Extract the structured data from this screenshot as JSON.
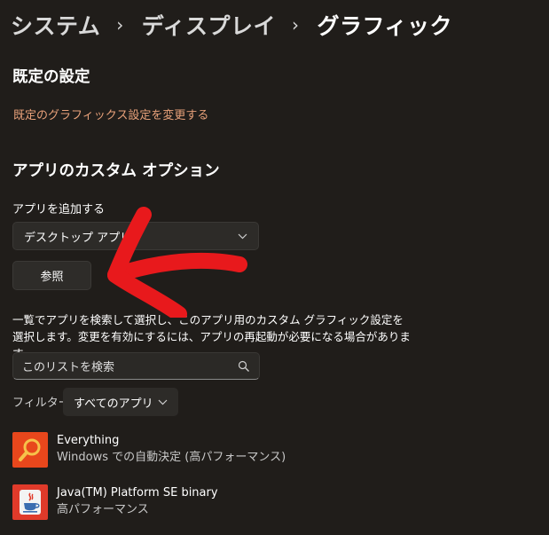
{
  "breadcrumb": {
    "items": [
      "システム",
      "ディスプレイ",
      "グラフィック"
    ],
    "separator": "›"
  },
  "default_settings": {
    "title": "既定の設定",
    "link": "既定のグラフィックス設定を変更する"
  },
  "custom_options": {
    "title": "アプリのカスタム オプション",
    "add_app_label": "アプリを追加する",
    "app_type_selected": "デスクトップ アプリ",
    "browse_button": "参照",
    "description": "一覧でアプリを検索して選択し、このアプリ用のカスタム グラフィック設定を選択します。変更を有効にするには、アプリの再起動が必要になる場合があります。",
    "search_placeholder": "このリストを検索",
    "filter_label": "フィルター:",
    "filter_selected": "すべてのアプリ"
  },
  "apps": [
    {
      "name": "Everything",
      "setting": "Windows での自動決定 (高パフォーマンス)",
      "icon": "everything-search-icon",
      "icon_color": "#e8471c"
    },
    {
      "name": "Java(TM) Platform SE binary",
      "setting": "高パフォーマンス",
      "icon": "java-icon",
      "icon_color": "#e03a2a"
    }
  ],
  "colors": {
    "background": "#201d1a",
    "link": "#e8a17a",
    "annotation_arrow": "#e8191c"
  },
  "annotation": {
    "icon": "red-arrow-annotation"
  }
}
